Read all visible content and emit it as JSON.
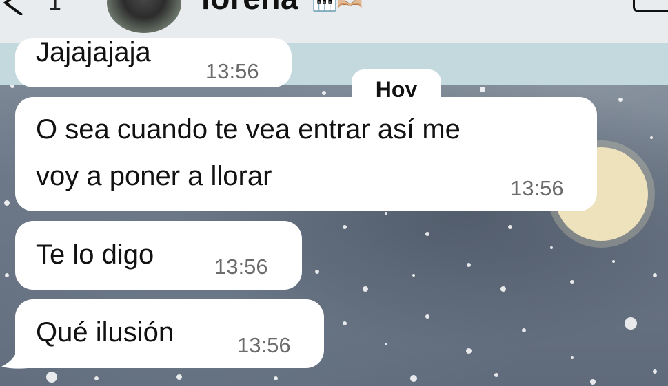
{
  "header": {
    "unread_count": "1",
    "contact_name": "lorena",
    "status_emojis": "🎹🫶🏼",
    "icons": [
      "chevron-left-icon",
      "video-call-icon"
    ]
  },
  "day_separator": "Hoy",
  "messages": [
    {
      "text": "Jajajajaja",
      "time": "13:56"
    },
    {
      "text_line1": "O sea cuando te vea entrar así me",
      "text_line2": "voy a poner a llorar",
      "time": "13:56"
    },
    {
      "text": "Te lo digo",
      "time": "13:56"
    },
    {
      "text": "Qué ilusión",
      "time": "13:56"
    }
  ],
  "colors": {
    "bubble": "#ffffff",
    "header": "#e9ecee",
    "band": "#c3d9dd",
    "moon": "#f3e7bf"
  }
}
